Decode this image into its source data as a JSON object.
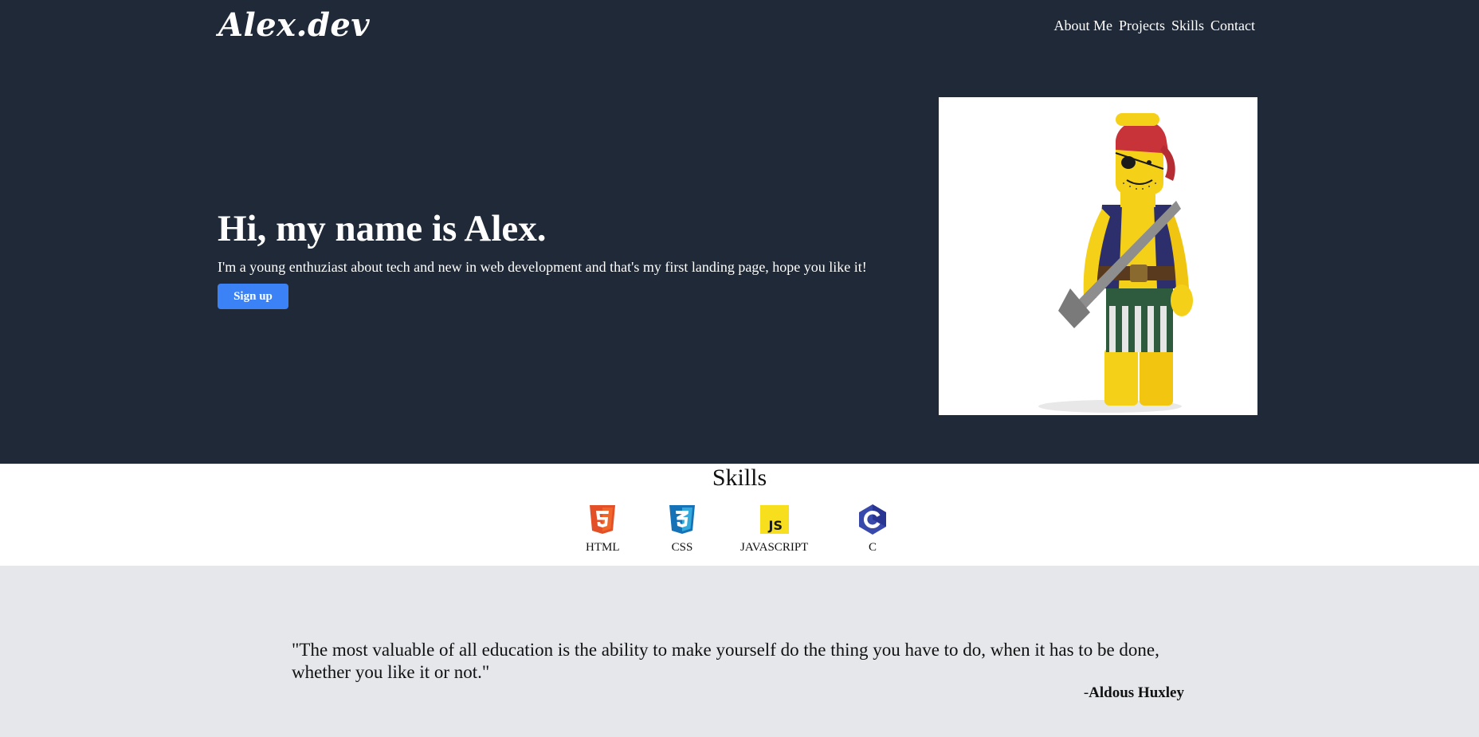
{
  "header": {
    "logo": "Alex.dev",
    "nav": [
      "About Me",
      "Projects",
      "Skills",
      "Contact"
    ]
  },
  "hero": {
    "title": "Hi, my name is Alex.",
    "subtitle": "I'm a young enthuziast about tech and new in web development and that's my first landing page, hope you like it!",
    "button_label": "Sign up",
    "image": "lego-pirate-minifigure"
  },
  "skills": {
    "title": "Skills",
    "items": [
      {
        "label": "HTML",
        "icon": "html5-icon",
        "color": "#e34f26"
      },
      {
        "label": "CSS",
        "icon": "css3-icon",
        "color": "#1572b6"
      },
      {
        "label": "JAVASCRIPT",
        "icon": "javascript-icon",
        "color": "#f7df1e"
      },
      {
        "label": "C",
        "icon": "c-language-icon",
        "color": "#3949ab"
      }
    ]
  },
  "quote": {
    "text": "\"The most valuable of all education is the ability to make yourself do the thing you have to do, when it has to be done, whether you like it or not.\"",
    "author_prefix": "-",
    "author": "Aldous Huxley"
  },
  "colors": {
    "hero_bg": "#1f2937",
    "button": "#3b82f6",
    "quote_bg": "#e5e7eb"
  }
}
